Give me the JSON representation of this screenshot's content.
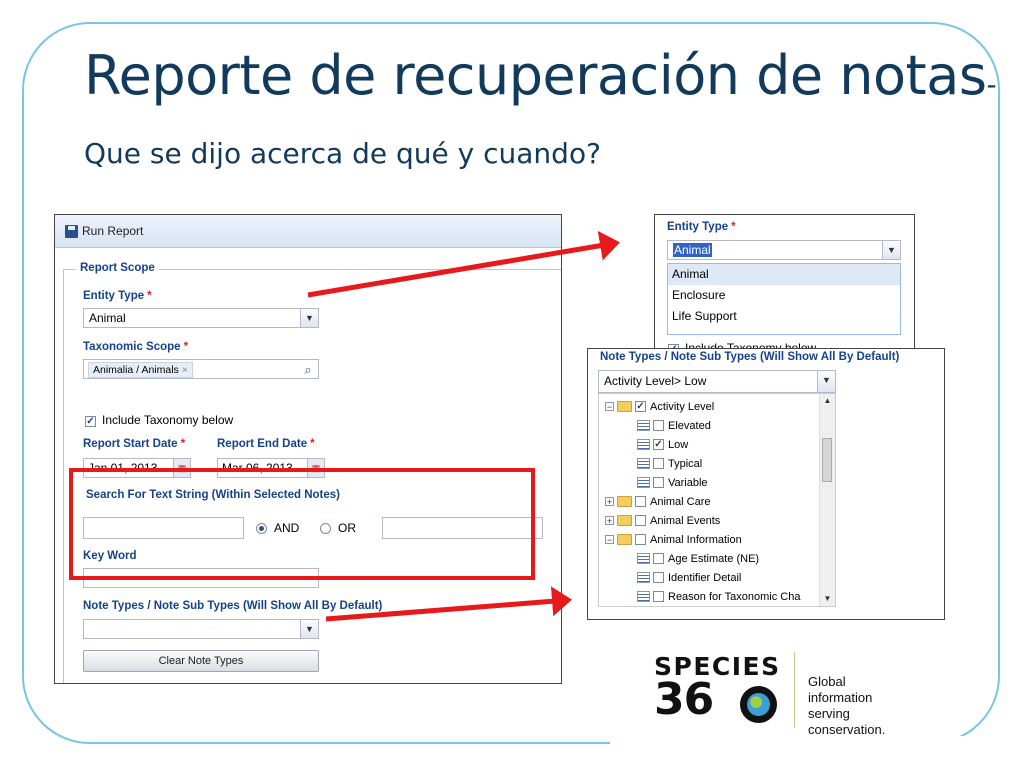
{
  "slide": {
    "title_main": "Reporte de recuperación de notas",
    "title_sub": "-Que se dijo acerca de qué y cuando?"
  },
  "run_report": {
    "window_title": "Run Report",
    "fieldset_legend": "Report Scope",
    "entity_type_label": "Entity Type",
    "entity_type_value": "Animal",
    "taxonomic_scope_label": "Taxonomic Scope",
    "taxonomic_chip": "Animalia / Animals",
    "chip_remove": "×",
    "include_taxonomy_label": "Include Taxonomy below",
    "include_taxonomy_checked": true,
    "start_date_label": "Report Start Date",
    "start_date_value": "Jan 01, 2013",
    "end_date_label": "Report End Date",
    "end_date_value": "Mar 06, 2013",
    "search_text_label": "Search For Text String (Within Selected Notes)",
    "and_label": "AND",
    "or_label": "OR",
    "selected_operator": "AND",
    "key_word_label": "Key Word",
    "note_types_label": "Note Types / Note Sub Types (Will Show All By Default)",
    "clear_button": "Clear Note Types",
    "required_mark": "*"
  },
  "entity_dropdown": {
    "label": "Entity Type",
    "value": "Animal",
    "options": [
      "Animal",
      "Enclosure",
      "Life Support"
    ],
    "selected_index": 0,
    "behind_text": "Include Taxonomy below"
  },
  "note_types_panel": {
    "label": "Note Types / Note Sub Types (Will Show All By Default)",
    "value": "Activity Level> Low",
    "tree": [
      {
        "label": "Activity Level",
        "level": 0,
        "kind": "folder",
        "expanded": true,
        "checked": true
      },
      {
        "label": "Elevated",
        "level": 1,
        "kind": "leaf",
        "checked": false
      },
      {
        "label": "Low",
        "level": 1,
        "kind": "leaf",
        "checked": true
      },
      {
        "label": "Typical",
        "level": 1,
        "kind": "leaf",
        "checked": false
      },
      {
        "label": "Variable",
        "level": 1,
        "kind": "leaf",
        "checked": false
      },
      {
        "label": "Animal Care",
        "level": 0,
        "kind": "folder",
        "expanded": false,
        "checked": false
      },
      {
        "label": "Animal Events",
        "level": 0,
        "kind": "folder",
        "expanded": false,
        "checked": false
      },
      {
        "label": "Animal Information",
        "level": 0,
        "kind": "folder",
        "expanded": true,
        "checked": false
      },
      {
        "label": "Age Estimate (NE)",
        "level": 1,
        "kind": "leaf",
        "checked": false
      },
      {
        "label": "Identifier Detail",
        "level": 1,
        "kind": "leaf",
        "checked": false
      },
      {
        "label": "Reason for Taxonomic Cha",
        "level": 1,
        "kind": "leaf",
        "checked": false
      }
    ]
  },
  "logo": {
    "word1": "SPECIES",
    "word2": "36",
    "tagline_line1": "Global information",
    "tagline_line2": "serving conservation."
  },
  "colors": {
    "title": "#113a5c",
    "field_label": "#15428b",
    "highlight_red": "#e8191a",
    "frame": "#7cc3e8"
  }
}
